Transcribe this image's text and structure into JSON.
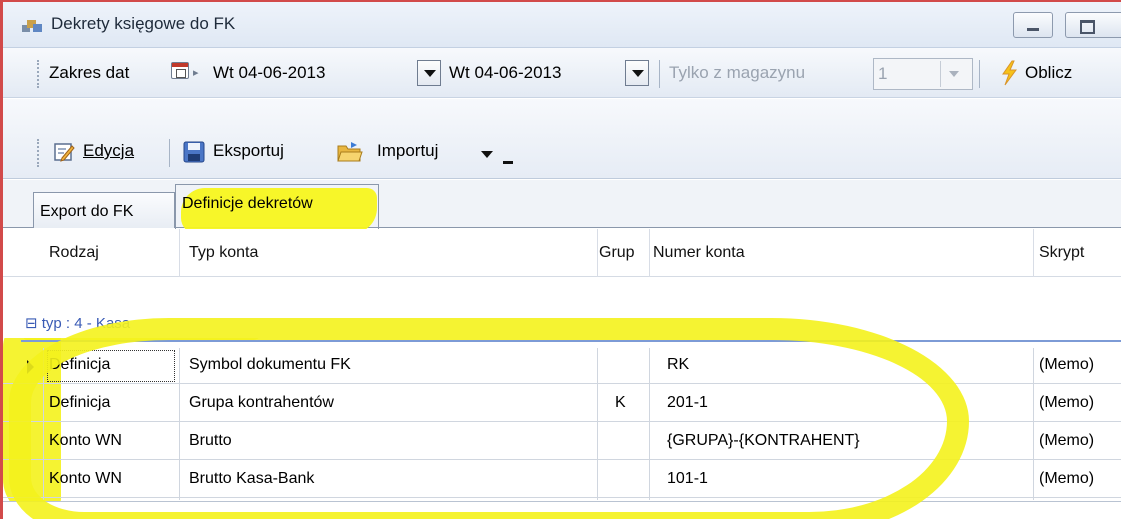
{
  "window": {
    "title": "Dekrety księgowe do FK"
  },
  "toolbar1": {
    "zakres_label": "Zakres dat",
    "date_from": "Wt 04-06-2013",
    "date_to": "Wt 04-06-2013",
    "tylko_label": "Tylko z magazynu",
    "magazyn_value": "1",
    "oblicz_label": "Oblicz"
  },
  "toolbar2": {
    "edycja_label": "Edycja",
    "eksportuj_label": "Eksportuj",
    "importuj_label": "Importuj"
  },
  "tabs": [
    {
      "label": "Export do FK"
    },
    {
      "label": "Definicje dekretów"
    }
  ],
  "grid": {
    "columns": [
      "Rodzaj",
      "Typ konta",
      "Grup",
      "Numer konta",
      "Skrypt"
    ],
    "group_label": "typ : 4 - Kasa",
    "rows": [
      {
        "rodzaj": "Definicja",
        "typ": "Symbol dokumentu FK",
        "grupa": "",
        "numer": "RK",
        "skrypt": "(Memo)"
      },
      {
        "rodzaj": "Definicja",
        "typ": "Grupa kontrahentów",
        "grupa": "K",
        "numer": "201-1",
        "skrypt": "(Memo)"
      },
      {
        "rodzaj": "Konto WN",
        "typ": "Brutto",
        "grupa": "",
        "numer": "{GRUPA}-{KONTRAHENT}",
        "skrypt": "(Memo)"
      },
      {
        "rodzaj": "Konto WN",
        "typ": "Brutto Kasa-Bank",
        "grupa": "",
        "numer": "101-1",
        "skrypt": "(Memo)"
      }
    ]
  },
  "colors": {
    "highlight": "#f4f21c",
    "window_border": "#d24a4a",
    "group_text": "#3a5bb5"
  }
}
